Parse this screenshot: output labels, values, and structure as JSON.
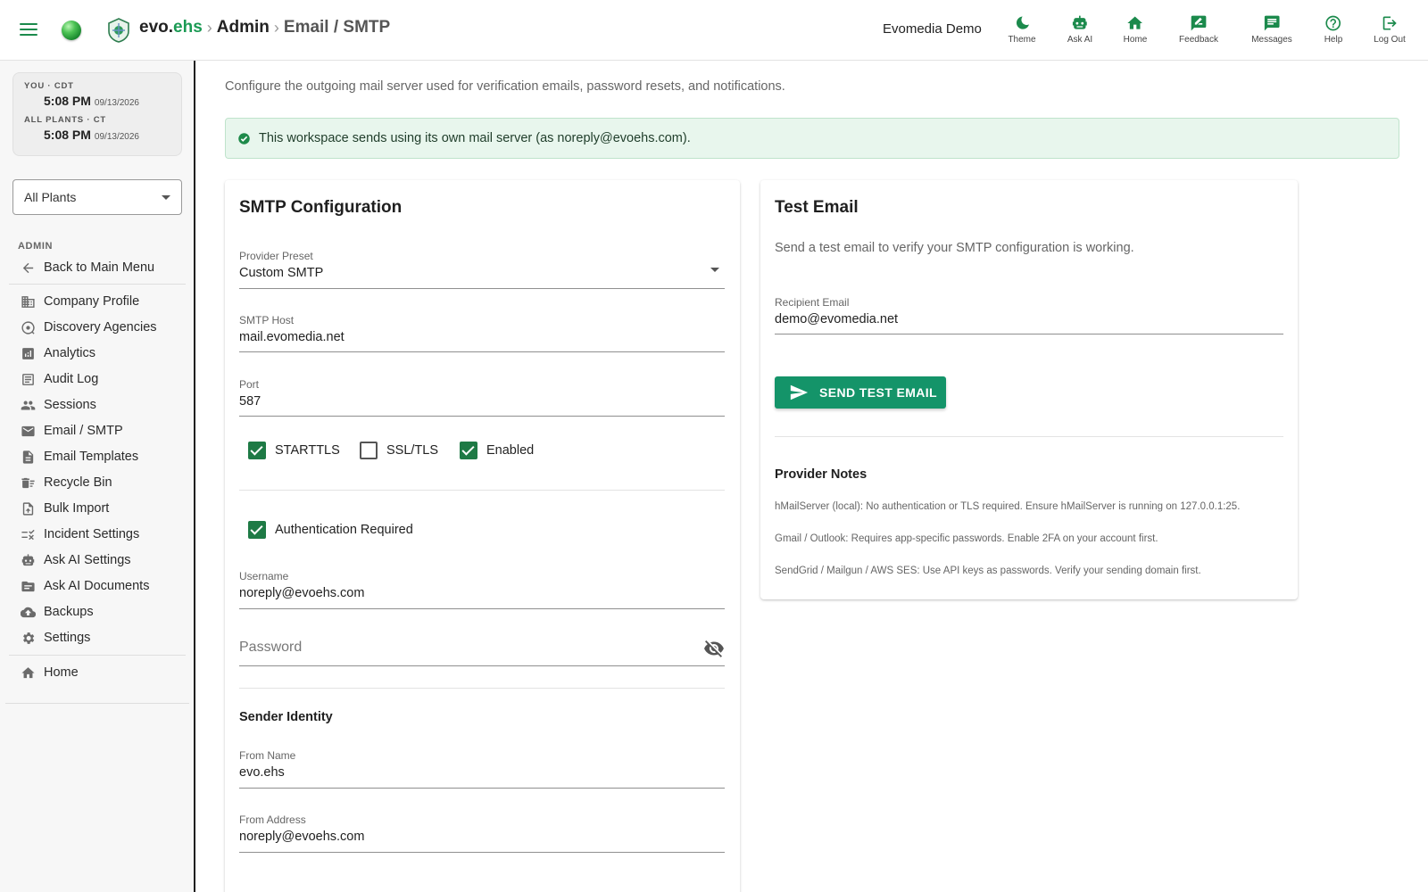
{
  "header": {
    "brand_evo": "evo.",
    "brand_ehs": "ehs",
    "sep": "›",
    "crumb_admin": "Admin",
    "crumb_current": "Email / SMTP",
    "org_name": "Evomedia Demo",
    "actions": [
      {
        "label": "Theme",
        "icon": "moon-icon"
      },
      {
        "label": "Ask AI",
        "icon": "robot-icon"
      },
      {
        "label": "Home",
        "icon": "home-icon"
      },
      {
        "label": "Feedback",
        "icon": "feedback-icon"
      },
      {
        "label": "Messages",
        "icon": "message-icon"
      },
      {
        "label": "Help",
        "icon": "help-icon"
      },
      {
        "label": "Log Out",
        "icon": "logout-icon"
      }
    ]
  },
  "sidebar": {
    "clock": {
      "you_label": "YOU · CDT",
      "you_time": "5:08 PM",
      "you_date": "09/13/2026",
      "plants_label": "ALL PLANTS · CT",
      "plants_time": "5:08 PM",
      "plants_date": "09/13/2026"
    },
    "plant_select": "All Plants",
    "section_label": "ADMIN",
    "back_label": "Back to Main Menu",
    "items": [
      {
        "label": "Company Profile",
        "icon": "building-icon"
      },
      {
        "label": "Discovery Agencies",
        "icon": "discovery-icon"
      },
      {
        "label": "Analytics",
        "icon": "analytics-icon"
      },
      {
        "label": "Audit Log",
        "icon": "audit-log-icon"
      },
      {
        "label": "Sessions",
        "icon": "people-icon"
      },
      {
        "label": "Email / SMTP",
        "icon": "email-icon"
      },
      {
        "label": "Email Templates",
        "icon": "document-icon"
      },
      {
        "label": "Recycle Bin",
        "icon": "recycle-bin-icon"
      },
      {
        "label": "Bulk Import",
        "icon": "import-icon"
      },
      {
        "label": "Incident Settings",
        "icon": "rule-icon"
      },
      {
        "label": "Ask AI Settings",
        "icon": "robot-icon"
      },
      {
        "label": "Ask AI Documents",
        "icon": "folder-icon"
      },
      {
        "label": "Backups",
        "icon": "cloud-icon"
      },
      {
        "label": "Settings",
        "icon": "gear-icon"
      }
    ],
    "home_label": "Home"
  },
  "main": {
    "description": "Configure the outgoing mail server used for verification emails, password resets, and notifications.",
    "alert": "This workspace sends using its own mail server (as noreply@evoehs.com).",
    "smtp": {
      "title": "SMTP Configuration",
      "provider_label": "Provider Preset",
      "provider_value": "Custom SMTP",
      "host_label": "SMTP Host",
      "host_value": "mail.evomedia.net",
      "port_label": "Port",
      "port_value": "587",
      "starttls_label": "STARTTLS",
      "starttls_checked": true,
      "ssl_label": "SSL/TLS",
      "ssl_checked": false,
      "enabled_label": "Enabled",
      "enabled_checked": true,
      "auth_label": "Authentication Required",
      "auth_checked": true,
      "username_label": "Username",
      "username_value": "noreply@evoehs.com",
      "password_placeholder": "Password",
      "sender_title": "Sender Identity",
      "from_name_label": "From Name",
      "from_name_value": "evo.ehs",
      "from_address_label": "From Address",
      "from_address_value": "noreply@evoehs.com"
    },
    "test": {
      "title": "Test Email",
      "description": "Send a test email to verify your SMTP configuration is working.",
      "recipient_label": "Recipient Email",
      "recipient_value": "demo@evomedia.net",
      "send_label": "SEND TEST EMAIL",
      "notes_title": "Provider Notes",
      "notes": [
        "hMailServer (local): No authentication or TLS required. Ensure hMailServer is running on 127.0.0.1:25.",
        "Gmail / Outlook: Requires app-specific passwords. Enable 2FA on your account first.",
        "SendGrid / Mailgun / AWS SES: Use API keys as passwords. Verify your sending domain first."
      ]
    }
  },
  "colors": {
    "accent": "#1b8a4c",
    "button": "#149469",
    "checkbox": "#1e7a45",
    "alert_bg": "#e8f6ed"
  }
}
